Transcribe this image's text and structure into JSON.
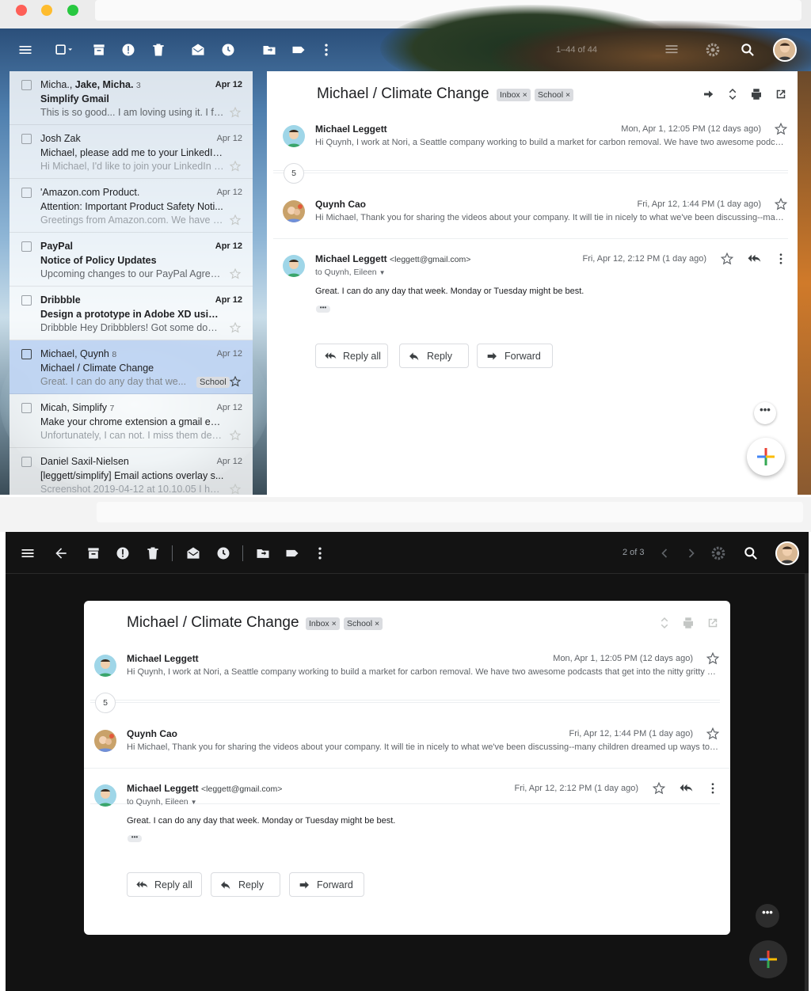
{
  "colors": {
    "accent_selected_row": "#c2d7f5",
    "label_chip": "#dadce0",
    "dark_bg": "#121212"
  },
  "window1": {
    "toolbar": {
      "page_counter": "1–44 of 44",
      "icons": [
        "menu-icon",
        "select-all-checkbox",
        "archive-icon",
        "report-spam-icon",
        "delete-icon",
        "mark-read-icon",
        "snooze-icon",
        "move-to-icon",
        "label-icon",
        "more-icon",
        "density-icon",
        "settings-icon",
        "search-icon",
        "account-avatar"
      ]
    },
    "inbox": [
      {
        "from_parts": [
          "Micha., ",
          "Jake, Micha."
        ],
        "count": "3",
        "date": "Apr 12",
        "subject": "Simplify Gmail",
        "snippet": "This is so good... I am loving using it. I fe...",
        "unread": true
      },
      {
        "from": "Josh Zak",
        "date": "Apr 12",
        "subject": "Michael, please add me to your LinkedIn ...",
        "snippet": "Hi Michael, I'd like to join your LinkedIn n...",
        "unread": false
      },
      {
        "from": "'Amazon.com Product.",
        "date": "Apr 12",
        "subject": "Attention: Important Product Safety Noti...",
        "snippet": "Greetings from Amazon.com. We have le...",
        "unread": false
      },
      {
        "from": "PayPal",
        "date": "Apr 12",
        "subject": "Notice of Policy Updates",
        "snippet": "Upcoming changes to our PayPal Agree...",
        "unread": true
      },
      {
        "from": "Dribbble",
        "date": "Apr 12",
        "subject": "Design a prototype in Adobe XD using th...",
        "snippet": "Dribbble Hey Dribbblers! Got some down...",
        "unread": true
      },
      {
        "from": "Michael, Quynh",
        "count": "8",
        "date": "Apr 12",
        "subject": "Michael / Climate Change",
        "snippet": "Great. I can do any day that we...",
        "label": "School",
        "selected": true
      },
      {
        "from": "Micah, Simplify",
        "count": "7",
        "date": "Apr 12",
        "subject": "Make your chrome extension a gmail ext...",
        "snippet": "Unfortunately, I can not. I miss them dea...",
        "unread": false
      },
      {
        "from": "Daniel Saxil-Nielsen",
        "date": "Apr 12",
        "subject": "[leggett/simplify] Email actions overlay s...",
        "snippet": "Screenshot 2019-04-12 at 10.10.05 I hav...",
        "unread": false
      }
    ]
  },
  "thread": {
    "title": "Michael / Climate Change",
    "labels": [
      "Inbox",
      "School"
    ],
    "label_remove": "×",
    "collapsed_count": "5",
    "messages": [
      {
        "sender": "Michael Leggett",
        "date": "Mon, Apr 1, 12:05 PM (12 days ago)",
        "snippet": "Hi Quynh, I work at Nori, a Seattle company working to build a market for carbon removal. We have two awesome podcasts that get into the nitty gritty of carbon removal"
      },
      {
        "sender": "Quynh Cao",
        "date": "Fri, Apr 12, 1:44 PM (1 day ago)",
        "snippet": "Hi Michael, Thank you for sharing the videos about your company. It will tie in nicely to what we've been discussing--many children dreamed up ways to help"
      },
      {
        "sender": "Michael Leggett",
        "email": "<leggett@gmail.com>",
        "date": "Fri, Apr 12, 2:12 PM (1 day ago)",
        "to": "to Quynh, Eileen",
        "body": "Great. I can do any day that week. Monday or Tuesday might be best.",
        "trimmed": "•••"
      }
    ],
    "buttons": {
      "reply_all": "Reply all",
      "reply": "Reply",
      "forward": "Forward"
    },
    "fab_more": "•••"
  },
  "window2": {
    "pager": "2 of 3"
  }
}
